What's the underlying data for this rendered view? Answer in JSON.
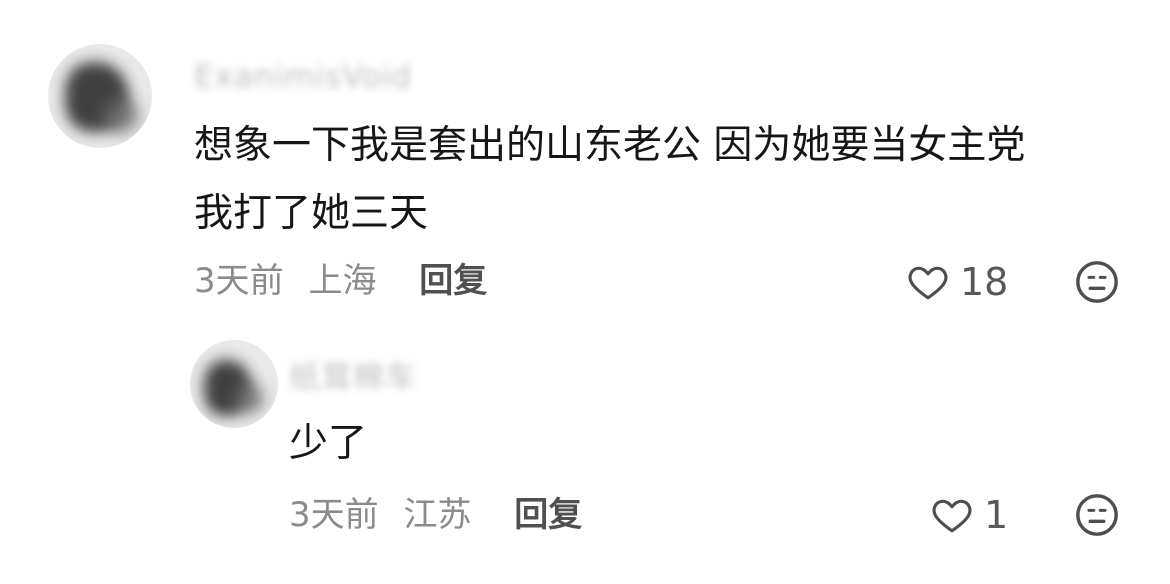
{
  "comments": [
    {
      "username": "ExanimisVoid",
      "text_lines": [
        "想象一下我是套出的山东老公 因为她要当女主党",
        "我打了她三天"
      ],
      "time": "3天前",
      "location": "上海",
      "reply_label": "回复",
      "like_count": "18",
      "avatar_icon": "avatar-icon",
      "like_icon": "heart-outline-icon",
      "reaction_icon": "expressionless-face-icon"
    },
    {
      "username": "纸茸棉车",
      "text": "少了",
      "time": "3天前",
      "location": "江苏",
      "reply_label": "回复",
      "like_count": "1",
      "avatar_icon": "avatar-icon",
      "like_icon": "heart-outline-icon",
      "reaction_icon": "expressionless-face-icon"
    }
  ]
}
